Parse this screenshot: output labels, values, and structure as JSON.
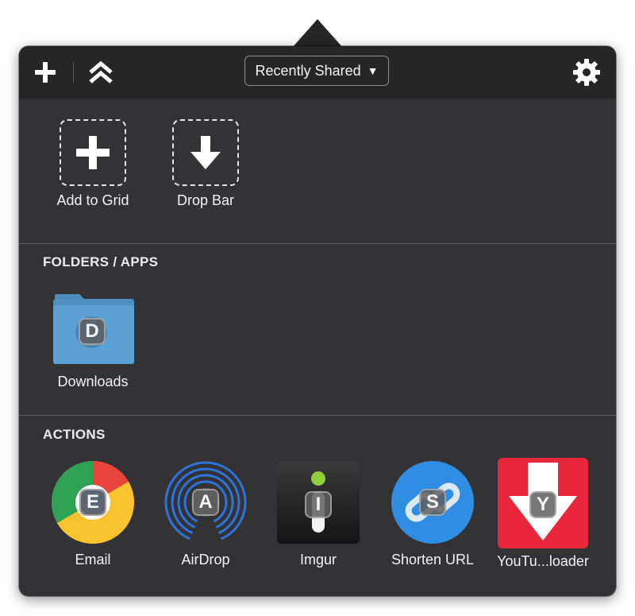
{
  "toolbar": {
    "add_icon": "plus-icon",
    "expand_icon": "double-chevron-up-icon",
    "dropdown_label": "Recently Shared",
    "dropdown_caret": "▼",
    "settings_icon": "gear-icon"
  },
  "grid": {
    "items": [
      {
        "label": "Add to Grid",
        "icon": "plus-icon"
      },
      {
        "label": "Drop Bar",
        "icon": "arrow-down-icon"
      }
    ]
  },
  "folders": {
    "title": "FOLDERS / APPS",
    "items": [
      {
        "label": "Downloads",
        "badge": "D",
        "icon": "folder-icon"
      }
    ]
  },
  "actions": {
    "title": "ACTIONS",
    "items": [
      {
        "label": "Email",
        "badge": "E",
        "icon": "chrome-icon"
      },
      {
        "label": "AirDrop",
        "badge": "A",
        "icon": "airdrop-icon"
      },
      {
        "label": "Imgur",
        "badge": "I",
        "icon": "imgur-icon"
      },
      {
        "label": "Shorten URL",
        "badge": "S",
        "icon": "link-icon"
      },
      {
        "label": "YouTu...loader",
        "badge": "Y",
        "icon": "youtube-downloader-icon"
      }
    ]
  },
  "colors": {
    "panel": "#333335",
    "toolbar": "#262627",
    "folder_blue": "#5b9fd1",
    "youtube_red": "#e8283a",
    "shorten_blue": "#2f8de4"
  }
}
